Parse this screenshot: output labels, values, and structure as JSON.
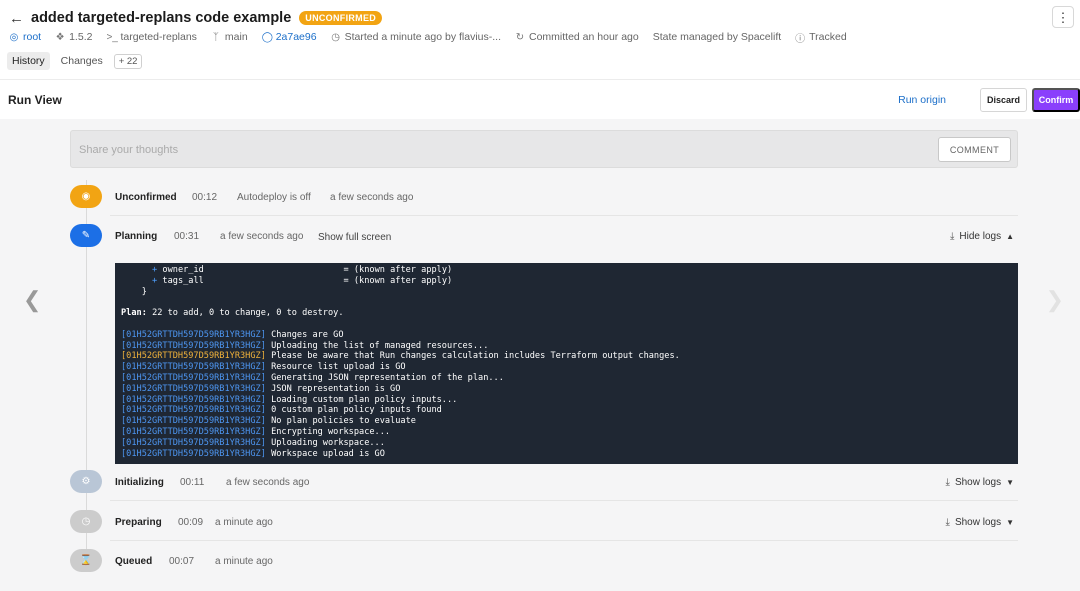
{
  "header": {
    "title": "added targeted-replans code example",
    "status_badge": "UNCONFIRMED",
    "menu_label": "⋮",
    "meta": {
      "stack": "root",
      "version": "1.5.2",
      "tool": "targeted-replans",
      "branch": "main",
      "commit": "2a7ae96",
      "started": "Started a minute ago by flavius-...",
      "committed": "Committed an hour ago",
      "state": "State managed by Spacelift",
      "tracked": "Tracked"
    },
    "tabs": [
      {
        "label": "History"
      },
      {
        "label": "Changes"
      }
    ],
    "changes_count": "+ 22"
  },
  "run_view": {
    "title": "Run View",
    "run_origin": "Run origin",
    "discard": "Discard",
    "confirm": "Confirm"
  },
  "comment": {
    "placeholder": "Share your thoughts",
    "button": "COMMENT"
  },
  "steps": [
    {
      "label": "Unconfirmed",
      "duration": "00:12",
      "extra": "Autodeploy is off",
      "time": "a few seconds ago",
      "color": "#f2a413"
    },
    {
      "label": "Planning",
      "duration": "00:31",
      "time": "a few seconds ago",
      "link": "Show full screen",
      "logs": "Hide logs",
      "color": "#1c6fe6"
    },
    {
      "label": "Initializing",
      "duration": "00:11",
      "time": "a few seconds ago",
      "logs": "Show logs",
      "color": "#b9c6d6"
    },
    {
      "label": "Preparing",
      "duration": "00:09",
      "time": "a minute ago",
      "logs": "Show logs",
      "color": "#cccccc"
    },
    {
      "label": "Queued",
      "duration": "00:07",
      "time": "a minute ago",
      "color": "#cccccc"
    }
  ],
  "logs": {
    "attr_lines": [
      {
        "name": "owner_id",
        "value": "= (known after apply)"
      },
      {
        "name": "tags_all",
        "value": "= (known after apply)"
      }
    ],
    "closing_brace": "}",
    "plan_label": "Plan:",
    "plan_summary": "22 to add, 0 to change, 0 to destroy.",
    "run_id": "[01H52GRTTDH597D59RB1YR3HGZ]",
    "messages": [
      {
        "text": "Changes are GO",
        "warn": false
      },
      {
        "text": "Uploading the list of managed resources...",
        "warn": false
      },
      {
        "text": "Please be aware that Run changes calculation includes Terraform output changes.",
        "warn": true
      },
      {
        "text": "Resource list upload is GO",
        "warn": false
      },
      {
        "text": "Generating JSON representation of the plan...",
        "warn": false
      },
      {
        "text": "JSON representation is GO",
        "warn": false
      },
      {
        "text": "Loading custom plan policy inputs...",
        "warn": false
      },
      {
        "text": "0 custom plan policy inputs found",
        "warn": false
      },
      {
        "text": "No plan policies to evaluate",
        "warn": false
      },
      {
        "text": "Encrypting workspace...",
        "warn": false
      },
      {
        "text": "Uploading workspace...",
        "warn": false
      },
      {
        "text": "Workspace upload is GO",
        "warn": false
      }
    ]
  }
}
